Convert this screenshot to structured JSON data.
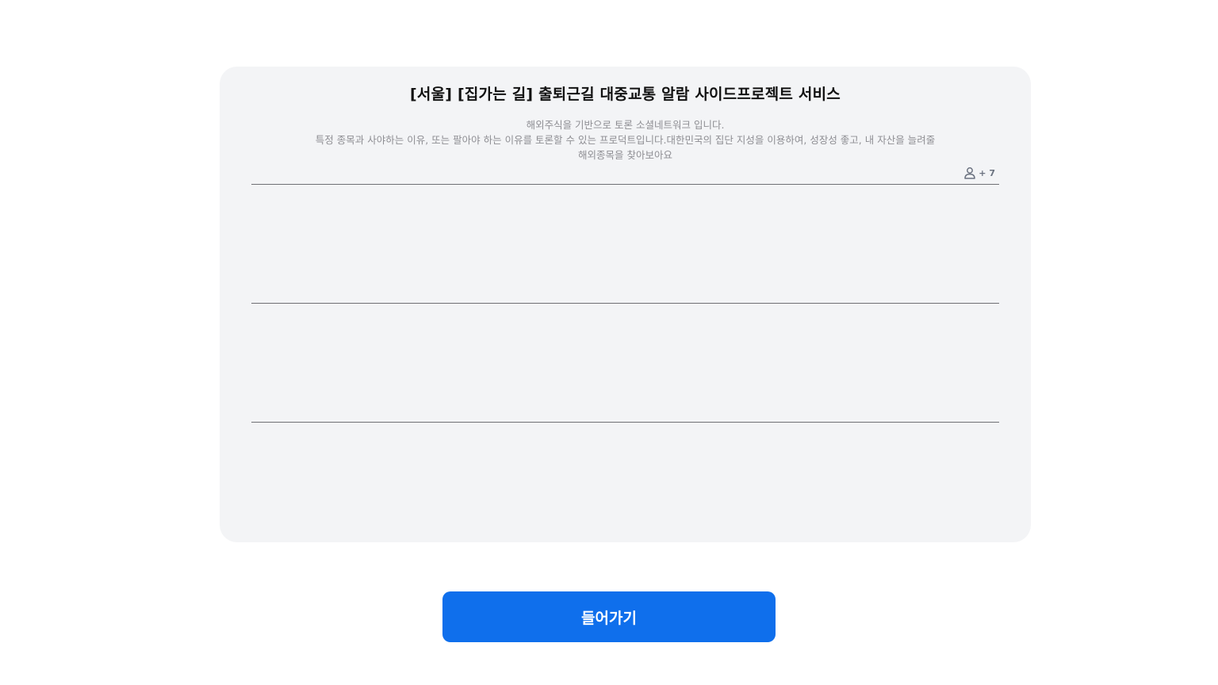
{
  "card": {
    "title": "[서울] [집가는 길] 출퇴근길 대중교통 알람 사이드프로젝트 서비스",
    "description_lines": [
      "해외주식을 기반으로 토론 소셜네트워크 입니다.",
      "특정 종목과 사야하는 이유, 또는 팔아야 하는 이유를 토론할 수 있는 프로덕트입니다.대한민국의 집단 지성을 이용하여, 성장성 좋고, 내 자산을 늘려줄",
      "해외종목을 찾아보아요"
    ],
    "members": {
      "icon": "user-icon",
      "count_label": "+ 7"
    }
  },
  "enter_button": {
    "label": "들어가기"
  },
  "colors": {
    "card_background": "#f3f4f6",
    "primary": "#0f6fec",
    "divider": "#6f6f74",
    "description_text": "#8e8e93"
  }
}
